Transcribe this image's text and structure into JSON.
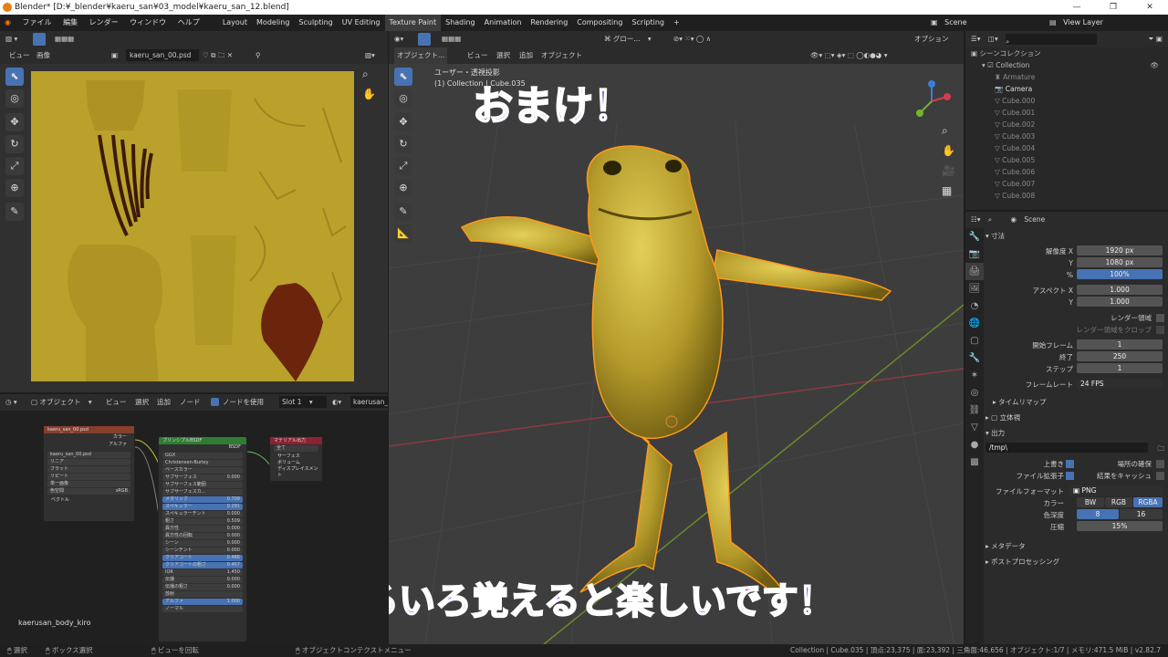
{
  "window": {
    "title": "Blender* [D:¥_blender¥kaeru_san¥03_model¥kaeru_san_12.blend]"
  },
  "menu": [
    "ファイル",
    "編集",
    "レンダー",
    "ウィンドウ",
    "ヘルプ"
  ],
  "workspace_tabs": [
    "Layout",
    "Modeling",
    "Sculpting",
    "UV Editing",
    "Texture Paint",
    "Shading",
    "Animation",
    "Rendering",
    "Compositing",
    "Scripting"
  ],
  "active_tab": "Texture Paint",
  "scene_name": "Scene",
  "view_layer": "View Layer",
  "image_editor": {
    "menu": [
      "ビュー",
      "画像"
    ],
    "image_name": "kaeru_san_00.psd"
  },
  "viewport": {
    "menu": [
      "オブジェクト...",
      "ビュー",
      "選択",
      "追加",
      "オブジェクト"
    ],
    "transform": "グロー...",
    "options_label": "オプション",
    "view_label": "ユーザー・透視投影",
    "collection_label": "(1) Collection | Cube.035"
  },
  "overlay": {
    "top": "おまけ！",
    "bottom": "いろいろ覚えると楽しいです！"
  },
  "node_editor": {
    "mode": "オブジェクト",
    "menu": [
      "ビュー",
      "選択",
      "追加",
      "ノード"
    ],
    "use_nodes": "ノードを使用",
    "slot": "Slot 1",
    "material": "kaerusan_b",
    "material_label": "kaerusan_body_kiro",
    "image_node": {
      "title": "kaeru_san_00.psd",
      "outputs": [
        "カラー",
        "アルファ"
      ],
      "file": "kaeru_san_00.psd",
      "rows": [
        "リニア",
        "フラット",
        "リピート",
        "単一画像"
      ],
      "colorspace_label": "色空間",
      "colorspace": "sRGB",
      "vector": "ベクトル"
    },
    "bsdf_node": {
      "title": "プリンシプルBSDF",
      "output": "BSDF",
      "dist": "GGX",
      "sss": "Christensen-Burley",
      "rows": [
        {
          "l": "ベースカラー",
          "v": ""
        },
        {
          "l": "サブサーフェス",
          "v": "0.000"
        },
        {
          "l": "サブサーフェス範囲",
          "v": ""
        },
        {
          "l": "サブサーフェスカ...",
          "v": ""
        },
        {
          "l": "メタリック",
          "v": "0.709"
        },
        {
          "l": "スペキュラー",
          "v": "0.291"
        },
        {
          "l": "スペキュラーチント",
          "v": "0.000"
        },
        {
          "l": "粗さ",
          "v": "0.509"
        },
        {
          "l": "異方性",
          "v": "0.000"
        },
        {
          "l": "異方性の回転",
          "v": "0.000"
        },
        {
          "l": "シーン",
          "v": "0.000"
        },
        {
          "l": "シーンチント",
          "v": "0.000"
        },
        {
          "l": "クリアコート",
          "v": "0.486"
        },
        {
          "l": "クリアコートの粗さ",
          "v": "0.457"
        },
        {
          "l": "IOR",
          "v": "1.450"
        },
        {
          "l": "伝播",
          "v": "0.000"
        },
        {
          "l": "伝播の粗さ",
          "v": "0.000"
        },
        {
          "l": "放射",
          "v": ""
        },
        {
          "l": "アルファ",
          "v": "1.000"
        },
        {
          "l": "ノーマル",
          "v": ""
        }
      ]
    },
    "output_node": {
      "title": "マテリアル出力",
      "target": "全て",
      "inputs": [
        "サーフェス",
        "ボリューム",
        "ディスプレイスメント"
      ]
    }
  },
  "outliner": {
    "header": "シーンコレクション",
    "collection": "Collection",
    "items": [
      "Armature",
      "Camera",
      "Cube.000",
      "Cube.001",
      "Cube.002",
      "Cube.003",
      "Cube.004",
      "Cube.005",
      "Cube.006",
      "Cube.007",
      "Cube.008"
    ]
  },
  "properties": {
    "scene": "Scene",
    "dimensions": "寸法",
    "res_x_label": "解像度 X",
    "res_x": "1920 px",
    "res_y_label": "Y",
    "res_y": "1080 px",
    "pct_label": "%",
    "pct": "100%",
    "aspect_x_label": "アスペクト X",
    "aspect_x": "1.000",
    "aspect_y_label": "Y",
    "aspect_y": "1.000",
    "render_region": "レンダー領域",
    "crop": "レンダー領域をクロップ",
    "frame_start_label": "開始フレーム",
    "frame_start": "1",
    "frame_end_label": "終了",
    "frame_end": "250",
    "frame_step_label": "ステップ",
    "frame_step": "1",
    "fps_label": "フレームレート",
    "fps": "24 FPS",
    "time_remap": "タイムリマップ",
    "stereo": "立体視",
    "output": "出力",
    "path": "/tmp\\",
    "overwrite": "上書き",
    "placeholders": "場所の確保",
    "file_ext": "ファイル拡張子",
    "cache": "結果をキャッシュ",
    "format_label": "ファイルフォーマット",
    "format": "PNG",
    "color_label": "カラー",
    "color_opts": [
      "BW",
      "RGB",
      "RGBA"
    ],
    "depth_label": "色深度",
    "depth_opts": [
      "8",
      "16"
    ],
    "compress_label": "圧縮",
    "compress": "15%",
    "metadata": "メタデータ",
    "post": "ポストプロセッシング"
  },
  "statusbar": {
    "select": "選択",
    "box": "ボックス選択",
    "rotate": "ビューを回転",
    "context": "オブジェクトコンテクストメニュー",
    "stats": "Collection | Cube.035 | 頂点:23,375 | 面:23,392 | 三角面:46,656 | オブジェクト:1/7 | メモリ:471.5 MiB | v2.82.7"
  }
}
